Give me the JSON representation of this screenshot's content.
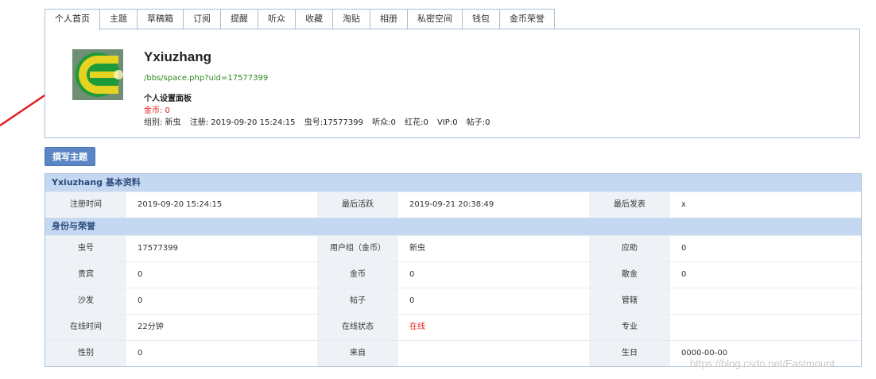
{
  "tabs": [
    "个人首页",
    "主题",
    "草稿箱",
    "订阅",
    "提醒",
    "听众",
    "收藏",
    "淘贴",
    "相册",
    "私密空间",
    "钱包",
    "金币荣誉"
  ],
  "profile": {
    "username": "Yxiuzhang",
    "link": "/bbs/space.php?uid=17577399",
    "settings_panel": "个人设置面板",
    "gold": "金币: 0",
    "group": "组别: 新虫",
    "registered": "注册: 2019-09-20 15:24:15",
    "bug_no": "虫号:17577399",
    "listeners": "听众:0",
    "flowers": "红花:0",
    "vip": "VIP:0",
    "posts": "帖子:0"
  },
  "write_button": "撰写主题",
  "basic": {
    "title": "Yxiuzhang 基本资料",
    "row": {
      "reg_label": "注册时间",
      "reg_value": "2019-09-20 15:24:15",
      "active_label": "最后活跃",
      "active_value": "2019-09-21 20:38:49",
      "lastpost_label": "最后发表",
      "lastpost_value": "x"
    }
  },
  "identity": {
    "title": "身份与荣誉",
    "rows": [
      {
        "l1": "虫号",
        "v1": "17577399",
        "l2": "用户组（金币）",
        "v2": "新虫",
        "l3": "应助",
        "v3": "0"
      },
      {
        "l1": "贵宾",
        "v1": "0",
        "l2": "金币",
        "v2": "0",
        "l3": "散金",
        "v3": "0"
      },
      {
        "l1": "沙发",
        "v1": "0",
        "l2": "帖子",
        "v2": "0",
        "l3": "管辖",
        "v3": ""
      },
      {
        "l1": "在线时间",
        "v1": "22分钟",
        "l2": "在线状态",
        "v2": "在线",
        "l3": "专业",
        "v3": ""
      },
      {
        "l1": "性别",
        "v1": "0",
        "l2": "来自",
        "v2": "",
        "l3": "生日",
        "v3": "0000-00-00"
      }
    ]
  },
  "watermark": "https://blog.csdn.net/Eastmount",
  "colors": {
    "accent": "#5b86c5",
    "header_bg": "#c5d8f1",
    "online": "#e02020",
    "link": "#2e8b1e",
    "arrow": "#e02020"
  }
}
